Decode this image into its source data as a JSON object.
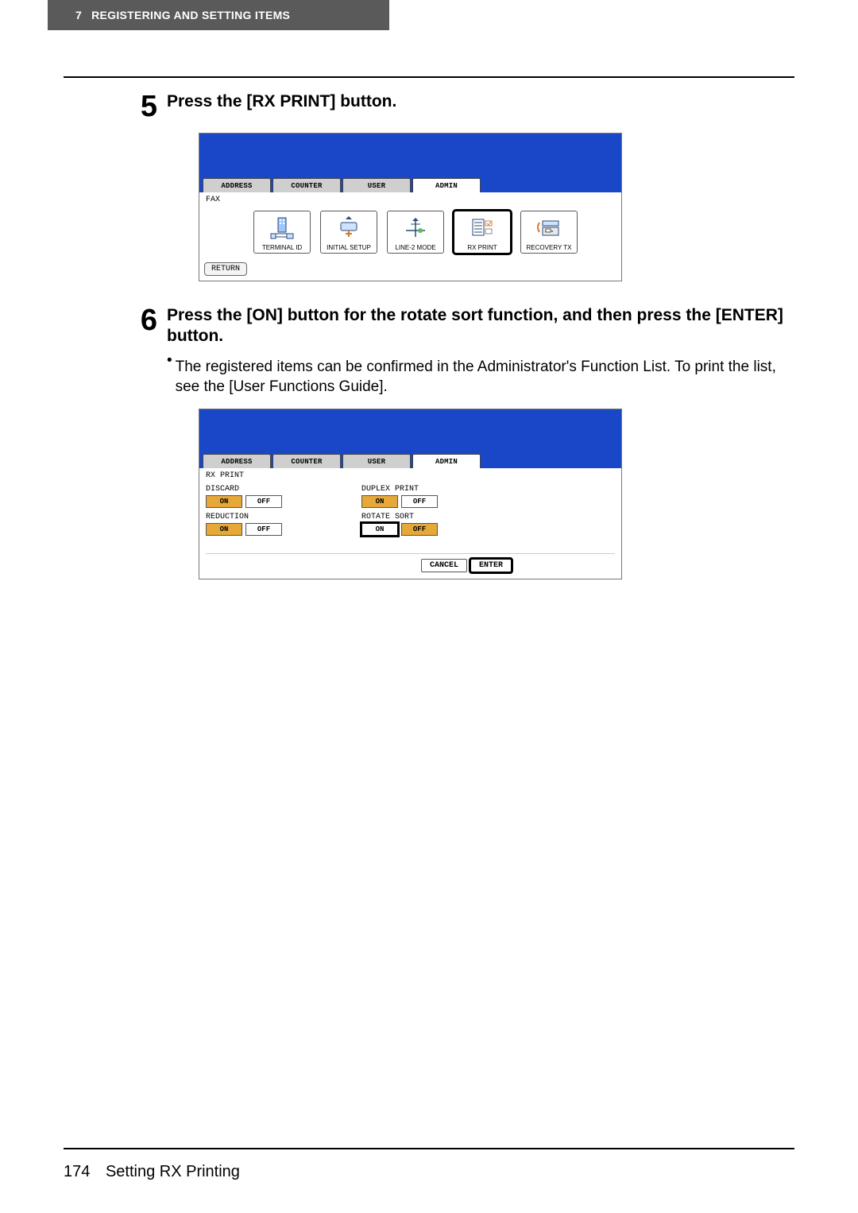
{
  "header": {
    "chapter_num": "7",
    "chapter_title": "REGISTERING AND SETTING ITEMS"
  },
  "steps": {
    "s5": {
      "num": "5",
      "title": "Press the [RX PRINT] button."
    },
    "s6": {
      "num": "6",
      "title": "Press the [ON] button for the rotate sort function, and then press the [ENTER] button.",
      "bullet": "The registered items can be confirmed in the Administrator's Function List. To print the list, see the [User Functions Guide]."
    }
  },
  "screen1": {
    "tabs": {
      "address": "ADDRESS",
      "counter": "COUNTER",
      "user": "USER",
      "admin": "ADMIN"
    },
    "crumb": "FAX",
    "icons": {
      "terminal_id": "TERMINAL ID",
      "initial_setup": "INITIAL SETUP",
      "line2_mode": "LINE-2 MODE",
      "rx_print": "RX PRINT",
      "recovery_tx": "RECOVERY TX"
    },
    "return": "RETURN"
  },
  "screen2": {
    "tabs": {
      "address": "ADDRESS",
      "counter": "COUNTER",
      "user": "USER",
      "admin": "ADMIN"
    },
    "crumb": "RX PRINT",
    "settings": {
      "discard": {
        "label": "DISCARD",
        "on": "ON",
        "off": "OFF"
      },
      "reduction": {
        "label": "REDUCTION",
        "on": "ON",
        "off": "OFF"
      },
      "duplex": {
        "label": "DUPLEX PRINT",
        "on": "ON",
        "off": "OFF"
      },
      "rotate": {
        "label": "ROTATE SORT",
        "on": "ON",
        "off": "OFF"
      }
    },
    "actions": {
      "cancel": "CANCEL",
      "enter": "ENTER"
    }
  },
  "footer": {
    "page": "174",
    "section": "Setting RX Printing"
  }
}
